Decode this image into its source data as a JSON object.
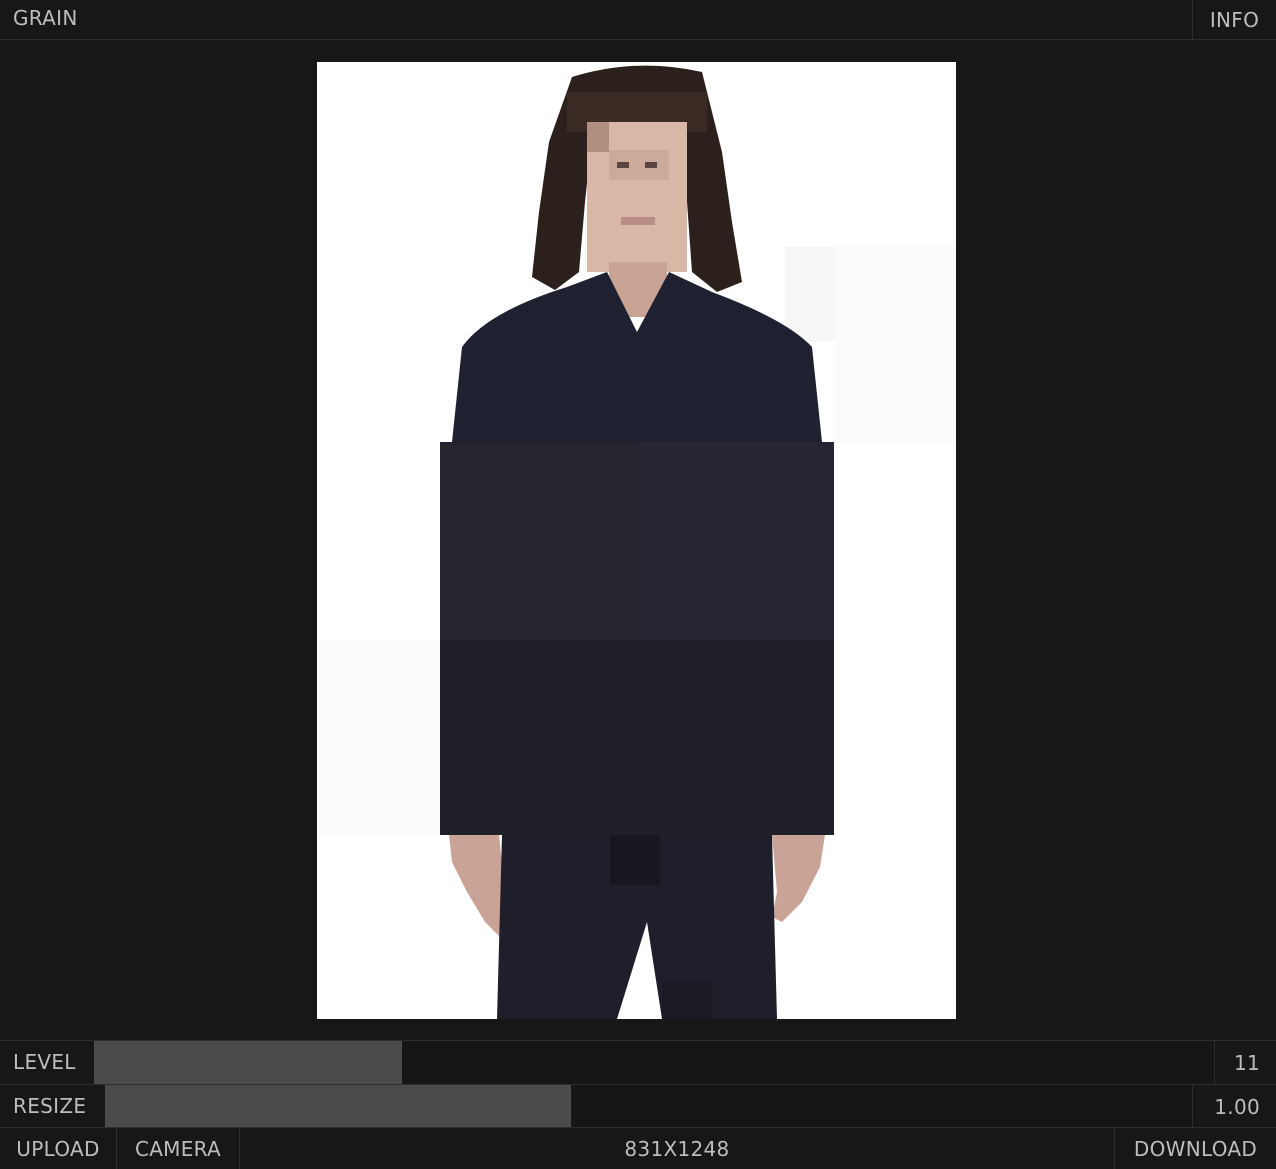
{
  "app": {
    "title": "GRAIN",
    "info_label": "INFO"
  },
  "controls": {
    "level": {
      "label": "LEVEL",
      "value": "11",
      "fill_fraction": 0.275
    },
    "resize": {
      "label": "RESIZE",
      "value": "1.00",
      "fill_fraction": 0.429
    }
  },
  "footer": {
    "upload_label": "UPLOAD",
    "camera_label": "CAMERA",
    "dimensions": "831X1248",
    "download_label": "DOWNLOAD"
  },
  "colors": {
    "background": "#171717",
    "text": "#bdbdbd",
    "slider_fill": "#4b4b4b",
    "divider": "#2e2e2e"
  }
}
